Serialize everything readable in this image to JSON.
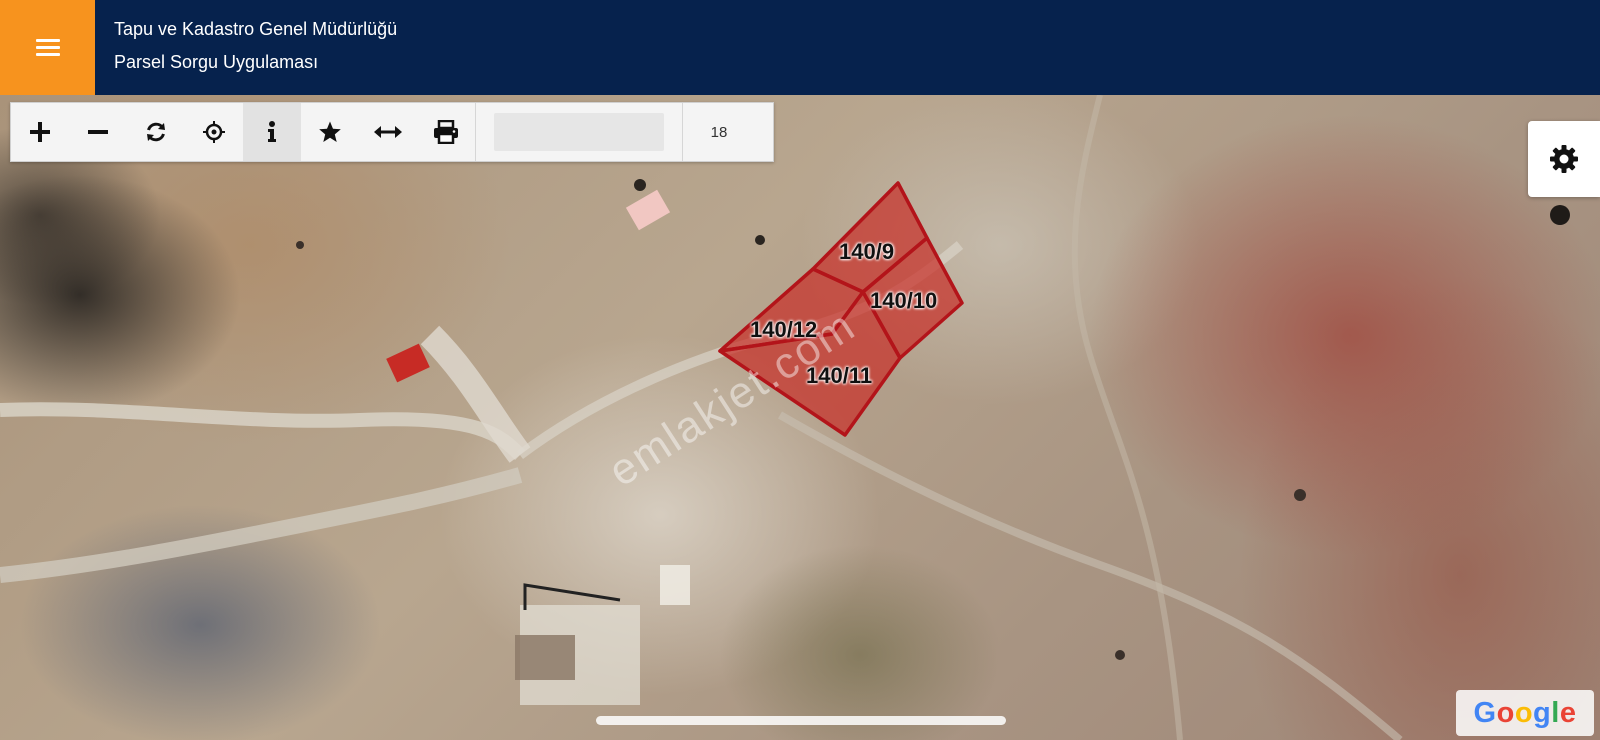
{
  "header": {
    "title": "Tapu ve Kadastro Genel Müdürlüğü",
    "subtitle": "Parsel Sorgu Uygulaması",
    "menu_icon": "hamburger-icon",
    "background_color": "#06224d",
    "menu_color": "#f7931e"
  },
  "toolbar": {
    "tools": [
      {
        "icon": "zoom-in-icon"
      },
      {
        "icon": "zoom-out-icon"
      },
      {
        "icon": "refresh-icon"
      },
      {
        "icon": "locate-icon"
      },
      {
        "icon": "info-icon",
        "active": true
      },
      {
        "icon": "star-icon"
      },
      {
        "icon": "measure-icon"
      },
      {
        "icon": "print-icon"
      }
    ],
    "zoom_level": "18"
  },
  "map": {
    "type": "satellite",
    "parcels": [
      {
        "label": "140/9"
      },
      {
        "label": "140/10"
      },
      {
        "label": "140/12"
      },
      {
        "label": "140/11"
      }
    ],
    "parcel_fill": "#c8302a",
    "parcel_stroke": "#b3141a",
    "watermark": "emlakjet.com"
  },
  "settings_icon": "gear-icon",
  "attribution": {
    "letters": [
      "G",
      "o",
      "o",
      "g",
      "l",
      "e"
    ],
    "colors": [
      "#4285f4",
      "#ea4335",
      "#fbbc05",
      "#4285f4",
      "#34a853",
      "#ea4335"
    ]
  }
}
